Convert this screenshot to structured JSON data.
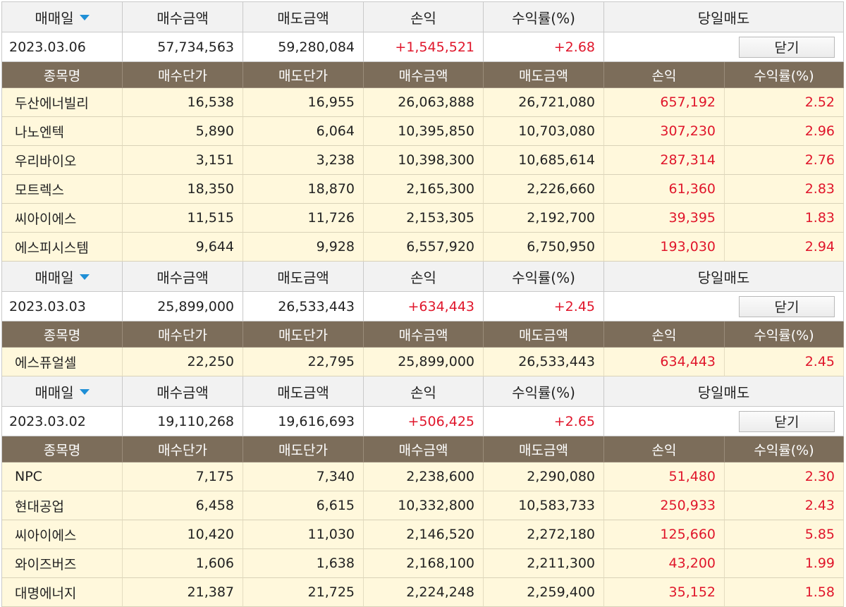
{
  "header_labels": {
    "date": "매매일",
    "buy_amount": "매수금액",
    "sell_amount": "매도금액",
    "profit": "손익",
    "return_rate": "수익률(%)",
    "same_day_sell": "당일매도"
  },
  "column_labels": {
    "name": "종목명",
    "buy_price": "매수단가",
    "sell_price": "매도단가",
    "buy_amount": "매수금액",
    "sell_amount": "매도금액",
    "profit": "손익",
    "return_rate": "수익률(%)"
  },
  "close_label": "닫기",
  "sort_icon": "triangle-down-icon",
  "colors": {
    "profit_red": "#e0162b",
    "header_brown": "#7c6d5a",
    "row_bg": "#fff8dc",
    "arrow_blue": "#1f8fd6"
  },
  "groups": [
    {
      "date": "2023.03.06",
      "buy_amount": "57,734,563",
      "sell_amount": "59,280,084",
      "profit": "+1,545,521",
      "return_rate": "+2.68",
      "rows": [
        {
          "name": "두산에너빌리",
          "buy_price": "16,538",
          "sell_price": "16,955",
          "buy_amount": "26,063,888",
          "sell_amount": "26,721,080",
          "profit": "657,192",
          "return_rate": "2.52"
        },
        {
          "name": "나노엔텍",
          "buy_price": "5,890",
          "sell_price": "6,064",
          "buy_amount": "10,395,850",
          "sell_amount": "10,703,080",
          "profit": "307,230",
          "return_rate": "2.96"
        },
        {
          "name": "우리바이오",
          "buy_price": "3,151",
          "sell_price": "3,238",
          "buy_amount": "10,398,300",
          "sell_amount": "10,685,614",
          "profit": "287,314",
          "return_rate": "2.76"
        },
        {
          "name": "모트렉스",
          "buy_price": "18,350",
          "sell_price": "18,870",
          "buy_amount": "2,165,300",
          "sell_amount": "2,226,660",
          "profit": "61,360",
          "return_rate": "2.83"
        },
        {
          "name": "씨아이에스",
          "buy_price": "11,515",
          "sell_price": "11,726",
          "buy_amount": "2,153,305",
          "sell_amount": "2,192,700",
          "profit": "39,395",
          "return_rate": "1.83"
        },
        {
          "name": "에스피시스템",
          "buy_price": "9,644",
          "sell_price": "9,928",
          "buy_amount": "6,557,920",
          "sell_amount": "6,750,950",
          "profit": "193,030",
          "return_rate": "2.94"
        }
      ]
    },
    {
      "date": "2023.03.03",
      "buy_amount": "25,899,000",
      "sell_amount": "26,533,443",
      "profit": "+634,443",
      "return_rate": "+2.45",
      "rows": [
        {
          "name": "에스퓨얼셀",
          "buy_price": "22,250",
          "sell_price": "22,795",
          "buy_amount": "25,899,000",
          "sell_amount": "26,533,443",
          "profit": "634,443",
          "return_rate": "2.45"
        }
      ]
    },
    {
      "date": "2023.03.02",
      "buy_amount": "19,110,268",
      "sell_amount": "19,616,693",
      "profit": "+506,425",
      "return_rate": "+2.65",
      "rows": [
        {
          "name": "NPC",
          "buy_price": "7,175",
          "sell_price": "7,340",
          "buy_amount": "2,238,600",
          "sell_amount": "2,290,080",
          "profit": "51,480",
          "return_rate": "2.30"
        },
        {
          "name": "현대공업",
          "buy_price": "6,458",
          "sell_price": "6,615",
          "buy_amount": "10,332,800",
          "sell_amount": "10,583,733",
          "profit": "250,933",
          "return_rate": "2.43"
        },
        {
          "name": "씨아이에스",
          "buy_price": "10,420",
          "sell_price": "11,030",
          "buy_amount": "2,146,520",
          "sell_amount": "2,272,180",
          "profit": "125,660",
          "return_rate": "5.85"
        },
        {
          "name": "와이즈버즈",
          "buy_price": "1,606",
          "sell_price": "1,638",
          "buy_amount": "2,168,100",
          "sell_amount": "2,211,300",
          "profit": "43,200",
          "return_rate": "1.99"
        },
        {
          "name": "대명에너지",
          "buy_price": "21,387",
          "sell_price": "21,725",
          "buy_amount": "2,224,248",
          "sell_amount": "2,259,400",
          "profit": "35,152",
          "return_rate": "1.58"
        }
      ]
    }
  ]
}
